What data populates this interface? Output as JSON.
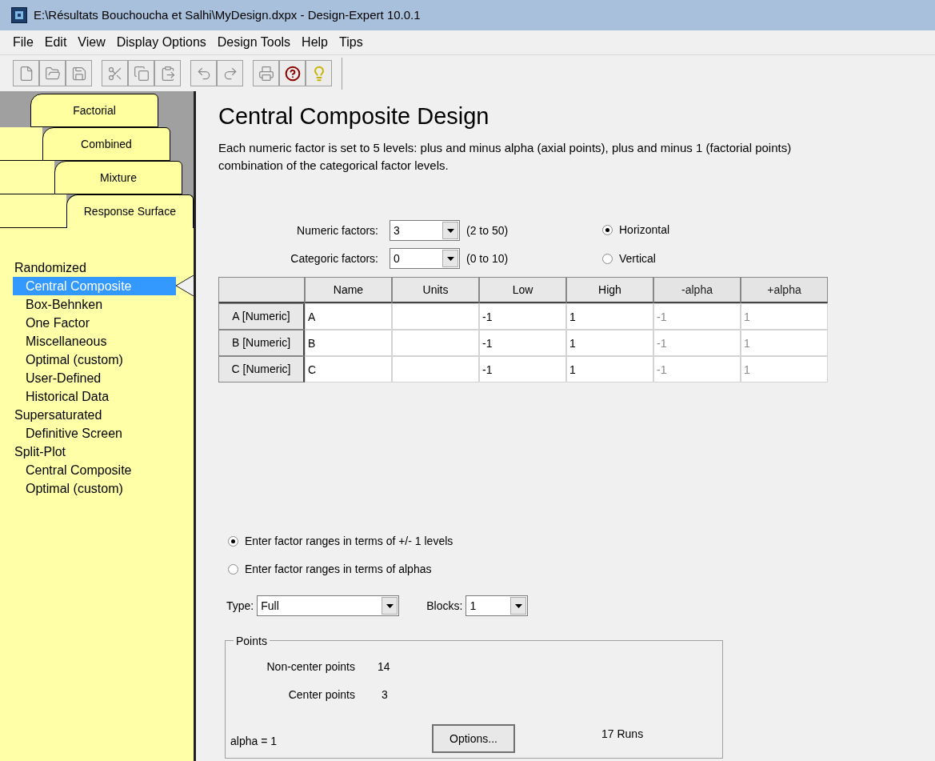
{
  "window": {
    "title": "E:\\Résultats Bouchoucha et Salhi\\MyDesign.dxpx - Design-Expert 10.0.1"
  },
  "menu": [
    "File",
    "Edit",
    "View",
    "Display Options",
    "Design Tools",
    "Help",
    "Tips"
  ],
  "toolbar": [
    [
      {
        "kind": "new",
        "disabled": true
      },
      {
        "kind": "open",
        "disabled": true
      },
      {
        "kind": "save",
        "disabled": true
      }
    ],
    [
      {
        "kind": "cut",
        "disabled": true
      },
      {
        "kind": "copy",
        "disabled": true
      },
      {
        "kind": "paste",
        "disabled": true
      }
    ],
    [
      {
        "kind": "undo",
        "disabled": true
      },
      {
        "kind": "redo",
        "disabled": true
      }
    ],
    [
      {
        "kind": "print",
        "disabled": true
      },
      {
        "kind": "help",
        "disabled": false
      },
      {
        "kind": "tip",
        "disabled": false
      }
    ]
  ],
  "design_tabs": [
    {
      "label": "Factorial",
      "selected": false
    },
    {
      "label": "Combined",
      "selected": false
    },
    {
      "label": "Mixture",
      "selected": false
    },
    {
      "label": "Response Surface",
      "selected": true
    }
  ],
  "design_list": [
    {
      "label": "Randomized",
      "kind": "group",
      "selected": false
    },
    {
      "label": "Central Composite",
      "kind": "item",
      "selected": true
    },
    {
      "label": "Box-Behnken",
      "kind": "item",
      "selected": false
    },
    {
      "label": "One Factor",
      "kind": "item",
      "selected": false
    },
    {
      "label": "Miscellaneous",
      "kind": "item",
      "selected": false
    },
    {
      "label": "Optimal (custom)",
      "kind": "item",
      "selected": false
    },
    {
      "label": "User-Defined",
      "kind": "item",
      "selected": false
    },
    {
      "label": "Historical Data",
      "kind": "item",
      "selected": false
    },
    {
      "label": "Supersaturated",
      "kind": "group",
      "selected": false
    },
    {
      "label": "Definitive Screen",
      "kind": "item",
      "selected": false
    },
    {
      "label": "Split-Plot",
      "kind": "group",
      "selected": false
    },
    {
      "label": "Central Composite",
      "kind": "item",
      "selected": false
    },
    {
      "label": "Optimal (custom)",
      "kind": "item",
      "selected": false
    }
  ],
  "title": "Central Composite Design",
  "description": [
    "Each numeric factor is set to 5 levels: plus and minus alpha (axial points), plus and minus 1 (factorial points)",
    "combination of the categorical factor levels."
  ],
  "factor_fields": [
    {
      "label": "Numeric factors:",
      "value": "3",
      "range": "(2 to 50)"
    },
    {
      "label": "Categoric factors:",
      "value": "0",
      "range": "(0 to 10)"
    }
  ],
  "orientation": [
    {
      "label": "Horizontal",
      "selected": true
    },
    {
      "label": "Vertical",
      "selected": false
    }
  ],
  "table": {
    "columns": [
      {
        "label": "Name",
        "disabled": false
      },
      {
        "label": "Units",
        "disabled": false
      },
      {
        "label": "Low",
        "disabled": false
      },
      {
        "label": "High",
        "disabled": false
      },
      {
        "label": "-alpha",
        "disabled": true
      },
      {
        "label": "+alpha",
        "disabled": true
      }
    ],
    "rows": [
      {
        "header": "A [Numeric]",
        "cells": [
          "A",
          "",
          "-1",
          "1",
          "-1",
          "1"
        ]
      },
      {
        "header": "B [Numeric]",
        "cells": [
          "B",
          "",
          "-1",
          "1",
          "-1",
          "1"
        ]
      },
      {
        "header": "C [Numeric]",
        "cells": [
          "C",
          "",
          "-1",
          "1",
          "-1",
          "1"
        ]
      }
    ]
  },
  "range_options": [
    {
      "label": "Enter factor ranges in terms of +/- 1 levels",
      "selected": true
    },
    {
      "label": "Enter factor ranges in terms of alphas",
      "selected": false
    }
  ],
  "type_field": {
    "label": "Type:",
    "value": "Full"
  },
  "blocks_field": {
    "label": "Blocks:",
    "value": "1"
  },
  "points": {
    "title": "Points",
    "non_center_label": "Non-center points",
    "non_center_value": "14",
    "center_label": "Center points",
    "center_value": "3",
    "alpha": "alpha =  1",
    "options_button": "Options...",
    "runs": "17 Runs"
  }
}
